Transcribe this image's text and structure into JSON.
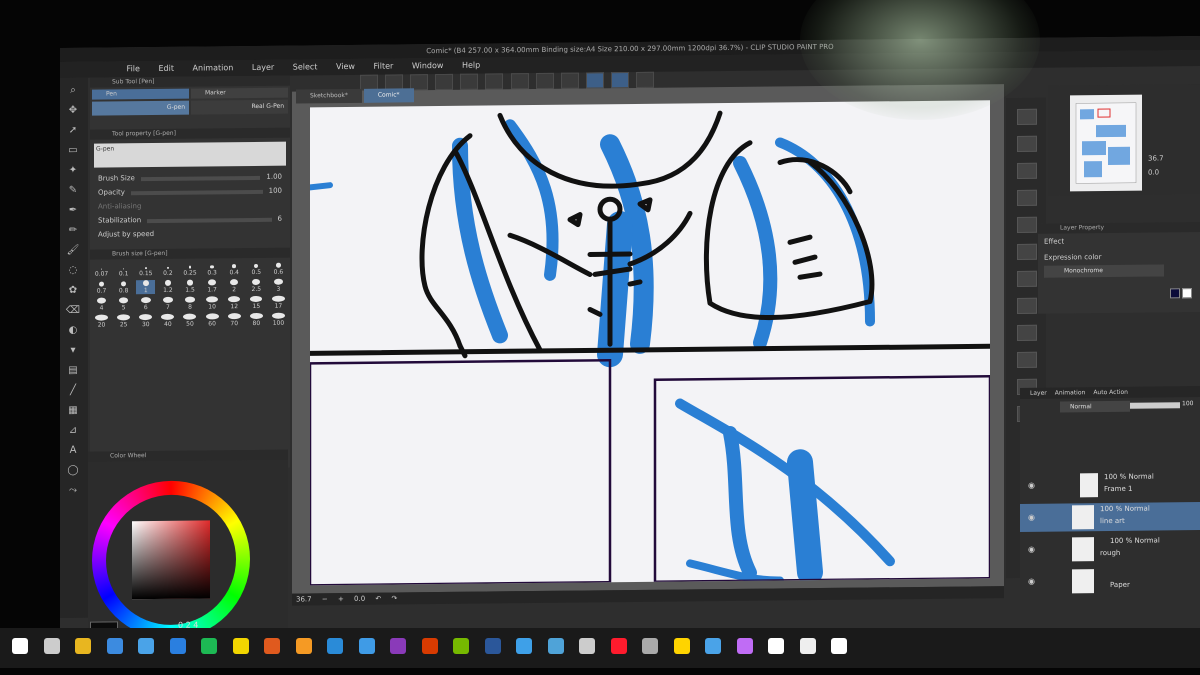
{
  "window": {
    "title": "Comic* (B4 257.00 x 364.00mm Binding size:A4 Size 210.00 x 297.00mm 1200dpi 36.7%) - CLIP STUDIO PAINT PRO"
  },
  "menu": [
    "File",
    "Edit",
    "Animation",
    "Layer",
    "Select",
    "View",
    "Filter",
    "Window",
    "Help"
  ],
  "doc_tabs": [
    "Sketchbook*",
    "Comic*"
  ],
  "sub_tool": {
    "header": "Sub Tool [Pen]",
    "tabs": [
      "Pen",
      "Marker"
    ],
    "brushes": [
      "G-pen",
      "Real G-Pen"
    ]
  },
  "tool_property": {
    "header": "Tool property [G-pen]",
    "name": "G-pen",
    "brush_size_label": "Brush Size",
    "brush_size_value": "1.00",
    "opacity_label": "Opacity",
    "opacity_value": "100",
    "antialias_label": "Anti-aliasing",
    "stabilization_label": "Stabilization",
    "stabilization_value": "6",
    "adjust_label": "Adjust by speed"
  },
  "brush_size": {
    "header": "Brush size [G-pen]",
    "sizes": [
      "0.07",
      "0.1",
      "0.15",
      "0.2",
      "0.25",
      "0.3",
      "0.4",
      "0.5",
      "0.6",
      "0.7",
      "0.8",
      "1",
      "1.2",
      "1.5",
      "1.7",
      "2",
      "2.5",
      "3",
      "4",
      "5",
      "6",
      "7",
      "8",
      "10",
      "12",
      "15",
      "17",
      "20",
      "25",
      "30",
      "40",
      "50",
      "60",
      "70",
      "80",
      "100"
    ],
    "selected": "1"
  },
  "color_wheel": {
    "header": "Color Wheel",
    "h": "0",
    "s": "2",
    "v": "4",
    "hue_color": "#e02b2b"
  },
  "status": {
    "zoom": "36.7",
    "angle": "0.0"
  },
  "navigator": {
    "zoom": "36.7",
    "angle": "0.0"
  },
  "layer_property": {
    "header": "Layer Property",
    "effect_label": "Effect",
    "expression_label": "Expression color",
    "expression_value": "Monochrome"
  },
  "layers": {
    "tabs": [
      "Layer",
      "Animation",
      "Auto Action"
    ],
    "blend_mode": "Normal",
    "opacity": "100",
    "items": [
      {
        "line1": "100 % Normal",
        "line2": "Frame 1"
      },
      {
        "line1": "100 % Normal",
        "line2": "line art"
      },
      {
        "line1": "100 % Normal",
        "line2": "rough"
      },
      {
        "line1": "",
        "line2": "Paper"
      }
    ]
  },
  "colors": {
    "accent": "#4a6e98",
    "sketch_blue": "#2a7fd4",
    "ink": "#111111",
    "panel": "#2e2e2e"
  },
  "taskbar_icons": [
    "start-icon",
    "task-view-icon",
    "chrome-icon",
    "store-icon",
    "mail-icon",
    "dropbox-icon",
    "spotify-icon",
    "sticky-notes-icon",
    "xmind-icon",
    "blender-icon",
    "cinema-icon",
    "media-icon",
    "onenote-icon",
    "office-icon",
    "nvidia-icon",
    "word-icon",
    "c-app-icon",
    "settings-icon",
    "unity-icon",
    "opera-icon",
    "steam-icon",
    "notes-icon",
    "phone-icon",
    "photos-icon",
    "files-icon",
    "clip-studio-icon",
    "clip-studio-paint-icon"
  ]
}
